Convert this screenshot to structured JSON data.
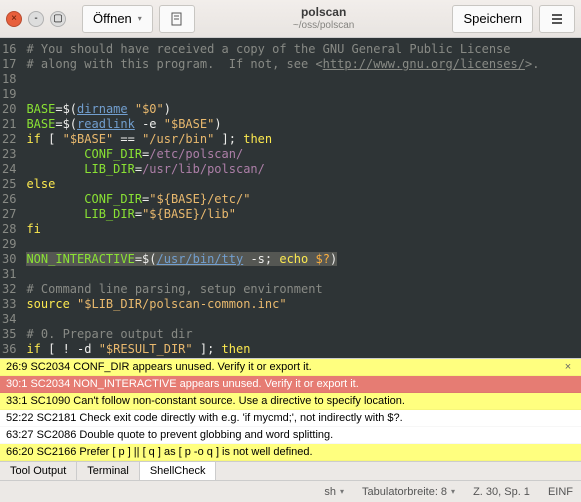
{
  "window": {
    "title": "polscan",
    "subtitle": "~/oss/polscan"
  },
  "toolbar": {
    "open_label": "Öffnen",
    "save_label": "Speichern"
  },
  "gutter": "16\n17\n18\n19\n20\n21\n22\n23\n24\n25\n26\n27\n28\n29\n30\n31\n32\n33\n34\n35\n36\n",
  "code": {
    "l16": "# You should have received a copy of the GNU General Public License",
    "l17a": "# along with this program.  If not, see <",
    "l17b": "http://www.gnu.org/licenses/",
    "l17c": ">.",
    "l20a": "BASE",
    "l20b": "=$(",
    "l20c": "dirname",
    "l20d": " \"$0\"",
    "l20e": ")",
    "l21a": "BASE",
    "l21b": "=$(",
    "l21c": "readlink",
    "l21d": " -e ",
    "l21e": "\"$BASE\"",
    "l21f": ")",
    "l22a": "if",
    "l22b": " [ ",
    "l22c": "\"$BASE\"",
    "l22d": " == ",
    "l22e": "\"/usr/bin\"",
    "l22f": " ]; ",
    "l22g": "then",
    "l23a": "        CONF_DIR",
    "l23b": "=",
    "l23c": "/etc/polscan/",
    "l24a": "        LIB_DIR",
    "l24b": "=",
    "l24c": "/usr/lib/polscan/",
    "l25a": "else",
    "l26a": "        CONF_DIR",
    "l26b": "=",
    "l26c": "\"${BASE}/etc/\"",
    "l27a": "        LIB_DIR",
    "l27b": "=",
    "l27c": "\"${BASE}/lib\"",
    "l28a": "fi",
    "l30a": "NON_INTERACTIVE",
    "l30b": "=$(",
    "l30c": "/usr/bin/tty",
    "l30d": " -s; ",
    "l30e": "echo",
    "l30f": " $?",
    "l30g": ")",
    "l32": "# Command line parsing, setup environment",
    "l33a": "source",
    "l33b": " \"$LIB_DIR/polscan-common.inc\"",
    "l35": "# 0. Prepare output dir",
    "l36a": "if",
    "l36b": " [ ! -d ",
    "l36c": "\"$RESULT_DIR\"",
    "l36d": " ]; ",
    "l36e": "then"
  },
  "messages": [
    {
      "cls": "msg-yellow",
      "text": "26:9 SC2034 CONF_DIR appears unused. Verify it or export it."
    },
    {
      "cls": "msg-red",
      "text": "30:1 SC2034 NON_INTERACTIVE appears unused. Verify it or export it."
    },
    {
      "cls": "msg-yellow",
      "text": "33:1 SC1090 Can't follow non-constant source. Use a directive to specify location."
    },
    {
      "cls": "msg-white",
      "text": "52:22 SC2181 Check exit code directly with e.g. 'if mycmd;', not indirectly with $?."
    },
    {
      "cls": "msg-white",
      "text": "63:27 SC2086 Double quote to prevent globbing and word splitting."
    },
    {
      "cls": "msg-yellow",
      "text": "66:20 SC2166 Prefer [ p ] || [ q ] as [ p -o q ] is not well defined."
    }
  ],
  "panel_tabs": {
    "tool_output": "Tool Output",
    "terminal": "Terminal",
    "shellcheck": "ShellCheck"
  },
  "status": {
    "lang": "sh",
    "tabwidth": "Tabulatorbreite: 8",
    "pos": "Z. 30, Sp. 1",
    "ins": "EINF"
  }
}
